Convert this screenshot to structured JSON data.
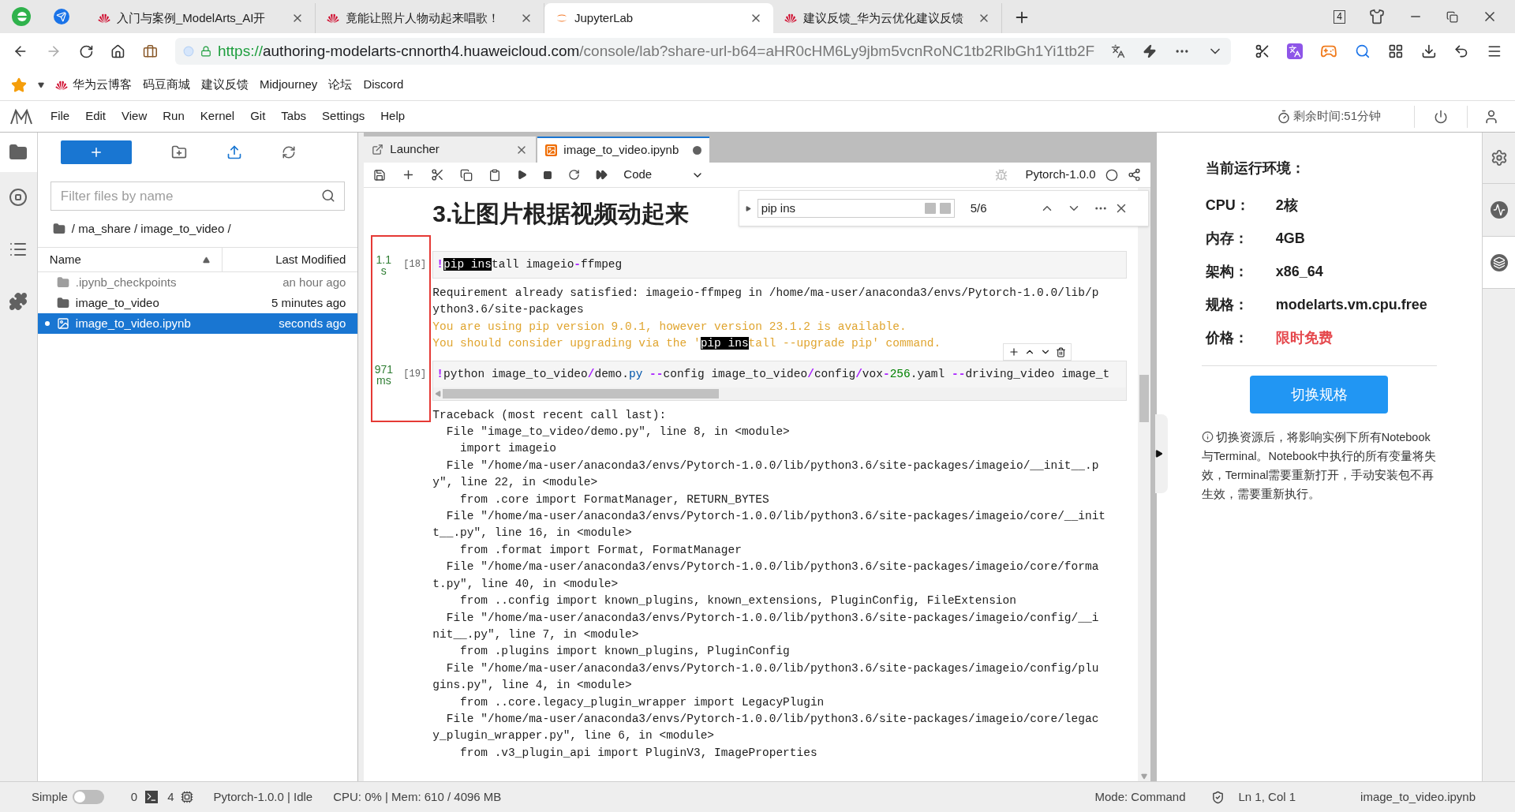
{
  "browser": {
    "tabs": [
      {
        "title": "入门与案例_ModelArts_AI开",
        "kind": "huawei",
        "selected": false
      },
      {
        "title": "竟能让照片人物动起来唱歌！",
        "kind": "huawei",
        "selected": false
      },
      {
        "title": "JupyterLab",
        "kind": "jupyter",
        "selected": true
      },
      {
        "title": "建议反馈_华为云优化建议反馈",
        "kind": "huawei",
        "selected": false
      }
    ],
    "tab_count": "4",
    "url": {
      "scheme": "https://",
      "host": "authoring-modelarts-cnnorth4.huaweicloud.com",
      "path": "/console/lab?share-url-b64=aHR0cHM6Ly9jbm5vcnRoNC1tb2RlbGh1Yi1tb2F"
    },
    "bookmarks": [
      {
        "label": "华为云博客",
        "kind": "huawei"
      },
      {
        "label": "码豆商城",
        "kind": "plain"
      },
      {
        "label": "建议反馈",
        "kind": "plain"
      },
      {
        "label": "Midjourney",
        "kind": "plain"
      },
      {
        "label": "论坛",
        "kind": "plain"
      },
      {
        "label": "Discord",
        "kind": "plain"
      }
    ]
  },
  "menu": {
    "items": [
      "File",
      "Edit",
      "View",
      "Run",
      "Kernel",
      "Git",
      "Tabs",
      "Settings",
      "Help"
    ],
    "timer": "剩余时间:51分钟"
  },
  "file_browser": {
    "filter": {
      "placeholder": "Filter files by name"
    },
    "breadcrumb": "/ ma_share / image_to_video /",
    "columns": [
      "Name",
      "Last Modified"
    ],
    "rows": [
      {
        "name": ".ipynb_checkpoints",
        "modified": "an hour ago",
        "kind": "folder",
        "hidden": true,
        "selected": false,
        "running": false
      },
      {
        "name": "image_to_video",
        "modified": "5 minutes ago",
        "kind": "folder",
        "hidden": false,
        "selected": false,
        "running": false
      },
      {
        "name": "image_to_video.ipynb",
        "modified": "seconds ago",
        "kind": "notebook",
        "hidden": false,
        "selected": true,
        "running": true
      }
    ]
  },
  "notebook": {
    "tabs": [
      {
        "label": "Launcher",
        "kind": "launcher",
        "selected": false,
        "dirty": false
      },
      {
        "label": "image_to_video.ipynb",
        "kind": "notebook",
        "selected": true,
        "dirty": true
      }
    ],
    "cell_type": "Code",
    "kernel": "Pytorch-1.0.0",
    "search": {
      "value": "pip ins",
      "count": "5/6"
    },
    "heading": "3.让图片根据视频动起来",
    "cells": [
      {
        "time_value": "1.1",
        "time_unit": "s",
        "prompt": "[18]",
        "scrollbar": false,
        "source": [
          {
            "text": "!",
            "kind": "op"
          },
          {
            "text": "pip ins",
            "kind": "match"
          },
          {
            "text": "tall imageio",
            "kind": "plain"
          },
          {
            "text": "-",
            "kind": "op"
          },
          {
            "text": "ffmpeg",
            "kind": "plain"
          }
        ],
        "outputs": [
          {
            "kind": "stdout",
            "parts": [
              {
                "text": "Requirement already satisfied: imageio-ffmpeg in /home/ma-user/anaconda3/envs/Pytorch-1.0.0/lib/p",
                "match": false
              }
            ]
          },
          {
            "kind": "stdout",
            "parts": [
              {
                "text": "ython3.6/site-packages",
                "match": false
              }
            ]
          },
          {
            "kind": "warning",
            "parts": [
              {
                "text": "You are using pip version 9.0.1, however version 23.1.2 is available.",
                "match": false
              }
            ]
          },
          {
            "kind": "warning",
            "parts": [
              {
                "text": "You should consider upgrading via the '",
                "match": false
              },
              {
                "text": "pip ins",
                "match": true
              },
              {
                "text": "tall --upgrade pip' command.",
                "match": false
              }
            ]
          }
        ]
      },
      {
        "time_value": "971",
        "time_unit": "ms",
        "prompt": "[19]",
        "scrollbar": true,
        "source": [
          {
            "text": "!",
            "kind": "op"
          },
          {
            "text": "python image_to_video",
            "kind": "plain"
          },
          {
            "text": "/",
            "kind": "op"
          },
          {
            "text": "demo.",
            "kind": "plain"
          },
          {
            "text": "py ",
            "kind": "attr"
          },
          {
            "text": "--",
            "kind": "op"
          },
          {
            "text": "config image_to_video",
            "kind": "plain"
          },
          {
            "text": "/",
            "kind": "op"
          },
          {
            "text": "config",
            "kind": "plain"
          },
          {
            "text": "/",
            "kind": "op"
          },
          {
            "text": "vox",
            "kind": "plain"
          },
          {
            "text": "-",
            "kind": "op"
          },
          {
            "text": "256",
            "kind": "num"
          },
          {
            "text": ".yaml ",
            "kind": "plain"
          },
          {
            "text": "--",
            "kind": "op"
          },
          {
            "text": "driving_video image_t",
            "kind": "plain"
          }
        ],
        "outputs": [
          {
            "kind": "stdout",
            "parts": [
              {
                "text": "Traceback (most recent call last):",
                "match": false
              }
            ]
          },
          {
            "kind": "stdout",
            "parts": [
              {
                "text": "  File \"image_to_video/demo.py\", line 8, in <module>",
                "match": false
              }
            ]
          },
          {
            "kind": "stdout",
            "parts": [
              {
                "text": "    import imageio",
                "match": false
              }
            ]
          },
          {
            "kind": "stdout",
            "parts": [
              {
                "text": "  File \"/home/ma-user/anaconda3/envs/Pytorch-1.0.0/lib/python3.6/site-packages/imageio/__init__.p",
                "match": false
              }
            ]
          },
          {
            "kind": "stdout",
            "parts": [
              {
                "text": "y\", line 22, in <module>",
                "match": false
              }
            ]
          },
          {
            "kind": "stdout",
            "parts": [
              {
                "text": "    from .core import FormatManager, RETURN_BYTES",
                "match": false
              }
            ]
          },
          {
            "kind": "stdout",
            "parts": [
              {
                "text": "  File \"/home/ma-user/anaconda3/envs/Pytorch-1.0.0/lib/python3.6/site-packages/imageio/core/__init",
                "match": false
              }
            ]
          },
          {
            "kind": "stdout",
            "parts": [
              {
                "text": "t__.py\", line 16, in <module>",
                "match": false
              }
            ]
          },
          {
            "kind": "stdout",
            "parts": [
              {
                "text": "    from .format import Format, FormatManager",
                "match": false
              }
            ]
          },
          {
            "kind": "stdout",
            "parts": [
              {
                "text": "  File \"/home/ma-user/anaconda3/envs/Pytorch-1.0.0/lib/python3.6/site-packages/imageio/core/forma",
                "match": false
              }
            ]
          },
          {
            "kind": "stdout",
            "parts": [
              {
                "text": "t.py\", line 40, in <module>",
                "match": false
              }
            ]
          },
          {
            "kind": "stdout",
            "parts": [
              {
                "text": "    from ..config import known_plugins, known_extensions, PluginConfig, FileExtension",
                "match": false
              }
            ]
          },
          {
            "kind": "stdout",
            "parts": [
              {
                "text": "  File \"/home/ma-user/anaconda3/envs/Pytorch-1.0.0/lib/python3.6/site-packages/imageio/config/__i",
                "match": false
              }
            ]
          },
          {
            "kind": "stdout",
            "parts": [
              {
                "text": "nit__.py\", line 7, in <module>",
                "match": false
              }
            ]
          },
          {
            "kind": "stdout",
            "parts": [
              {
                "text": "    from .plugins import known_plugins, PluginConfig",
                "match": false
              }
            ]
          },
          {
            "kind": "stdout",
            "parts": [
              {
                "text": "  File \"/home/ma-user/anaconda3/envs/Pytorch-1.0.0/lib/python3.6/site-packages/imageio/config/plu",
                "match": false
              }
            ]
          },
          {
            "kind": "stdout",
            "parts": [
              {
                "text": "gins.py\", line 4, in <module>",
                "match": false
              }
            ]
          },
          {
            "kind": "stdout",
            "parts": [
              {
                "text": "    from ..core.legacy_plugin_wrapper import LegacyPlugin",
                "match": false
              }
            ]
          },
          {
            "kind": "stdout",
            "parts": [
              {
                "text": "  File \"/home/ma-user/anaconda3/envs/Pytorch-1.0.0/lib/python3.6/site-packages/imageio/core/legac",
                "match": false
              }
            ]
          },
          {
            "kind": "stdout",
            "parts": [
              {
                "text": "y_plugin_wrapper.py\", line 6, in <module>",
                "match": false
              }
            ]
          },
          {
            "kind": "stdout",
            "parts": [
              {
                "text": "    from .v3_plugin_api import PluginV3, ImageProperties",
                "match": false
              }
            ]
          }
        ]
      }
    ]
  },
  "resource_panel": {
    "title": "当前运行环境：",
    "specs": [
      {
        "label": "CPU：",
        "value": "2核",
        "highlight": false
      },
      {
        "label": "内存：",
        "value": "4GB",
        "highlight": false
      },
      {
        "label": "架构：",
        "value": "x86_64",
        "highlight": false
      },
      {
        "label": "规格：",
        "value": "modelarts.vm.cpu.free",
        "highlight": false
      },
      {
        "label": "价格：",
        "value": "限时免费",
        "highlight": true
      }
    ],
    "button": "切换规格",
    "note": "切换资源后，将影响实例下所有Notebook与Terminal。Notebook中执行的所有变量将失效，Terminal需要重新打开，手动安装包不再生效，需要重新执行。"
  },
  "status_bar": {
    "mode_label": "Simple",
    "simple_on": false,
    "terminals": "0",
    "kernels": "4",
    "kernel_status": "Pytorch-1.0.0 | Idle",
    "resources": "CPU: 0% | Mem: 610 / 4096 MB",
    "mode": "Mode: Command",
    "cursor": "Ln 1, Col 1",
    "file": "image_to_video.ipynb"
  }
}
